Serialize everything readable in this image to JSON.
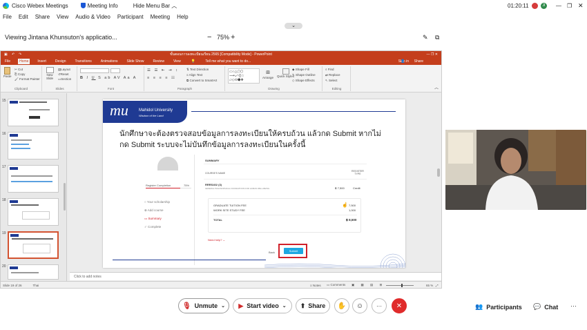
{
  "titlebar": {
    "app_name": "Cisco Webex Meetings",
    "meeting_info": "Meeting Info",
    "hide_menu_bar": "Hide Menu Bar",
    "clock": "01:20:11",
    "avatar1": "",
    "avatar2": "JI"
  },
  "menu": [
    "File",
    "Edit",
    "Share",
    "View",
    "Audio & Video",
    "Participant",
    "Meeting",
    "Help"
  ],
  "viewbar": {
    "viewing": "Viewing Jintana Khunsuton's applicatio...",
    "zoom": "75%",
    "minus": "−",
    "plus": "+"
  },
  "ppt": {
    "doc_title": "ขั้นตอนการลงทะเบียนเรียน 2565 [Compatibility Mode] - PowerPoint",
    "sign_in": "Sign in",
    "share": "Share",
    "tell_me": "Tell me what you want to do...",
    "tabs": [
      "File",
      "Home",
      "Insert",
      "Design",
      "Transitions",
      "Animations",
      "Slide Show",
      "Review",
      "View"
    ],
    "groups": [
      "Clipboard",
      "Slides",
      "Font",
      "Paragraph",
      "Drawing",
      "Editing"
    ],
    "ribbon": {
      "paste": "Paste",
      "cut": "Cut",
      "copy": "Copy",
      "format_painter": "Format Painter",
      "new_slide": "New Slide",
      "layout": "Layout",
      "reset": "Reset",
      "section": "Section",
      "text_direction": "Text Direction",
      "align_text": "Align Text",
      "smartart": "Convert to SmartArt",
      "arrange": "Arrange",
      "quick_styles": "Quick Styles",
      "shape_fill": "Shape Fill",
      "shape_outline": "Shape Outline",
      "shape_effects": "Shape Effects",
      "find": "Find",
      "replace": "Replace",
      "select": "Select"
    },
    "slide_numbers": [
      "15",
      "16",
      "17",
      "18",
      "19",
      "20"
    ],
    "notes_placeholder": "Click to add notes",
    "status_left": "Slide 19 of 26",
    "status_lang": "Thai",
    "status_notes": "Notes",
    "status_comments": "Comments",
    "status_zoom": "65 %"
  },
  "slide": {
    "logo_brand": "Mahidol University",
    "logo_tagline": "Wisdom of the Land",
    "heading_line1": "นักศึกษาจะต้องตรวจสอบข้อมูลการลงทะเบียนให้ครบถ้วน แล้วกด Submit หากไม่",
    "heading_line2": "กด Submit ระบบจะไม่บันทึกข้อมูลการลงทะเบียนในครั้งนี้",
    "progress_label": "Register Completion",
    "progress_value": "75%",
    "progress_fraction": 0.75,
    "steps": [
      "Your scholarship",
      "Add course",
      "Summary",
      "Complete"
    ],
    "summary_title": "SUMMARY",
    "col_course": "COURSE'S NAME",
    "col_register": "REGISTER TYPE",
    "course_code": "RRRS402 (3)",
    "course_desc": "GENERAL PHILOSOPHICAL FOUNDATIONS FOR HUMAN WELL-BEING",
    "course_price": "฿ 7,500",
    "course_type": "Credit",
    "fee1_label": "GRADUATE TUITION FEE",
    "fee1_value": "7,500",
    "fee2_label": "WORK SITE STUDY FEE",
    "fee2_value": "1,000",
    "total_label": "TOTAL",
    "total_value": "฿ 8,500",
    "need_help": "Need help?",
    "back_btn": "Back",
    "submit_btn": "Submit"
  },
  "controls": {
    "unmute": "Unmute",
    "start_video": "Start video",
    "share": "Share",
    "participants": "Participants",
    "chat": "Chat",
    "more": "···",
    "end": "✕"
  },
  "colors": {
    "ppt_brand": "#c43e1c",
    "mu_blue": "#1f3a93",
    "submit": "#1ea7e1",
    "highlight": "#d0202a",
    "end_red": "#e02b2b"
  }
}
